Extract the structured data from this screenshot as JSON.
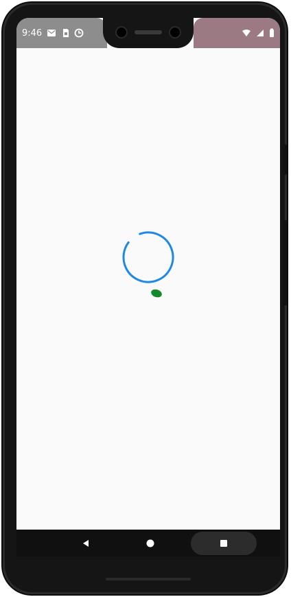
{
  "statusBar": {
    "time": "9:46",
    "leftIcons": [
      "mail-icon",
      "sim-icon",
      "data-saver-icon"
    ],
    "rightIcons": [
      "wifi-icon",
      "signal-icon",
      "battery-icon"
    ]
  },
  "screen": {
    "loading": {
      "state": "loading",
      "ringColor": "#1e88e5",
      "dotColor": "#148a2b"
    }
  },
  "navigationBar": {
    "back": "back-icon",
    "home": "home-icon",
    "recents": "recents-icon"
  }
}
